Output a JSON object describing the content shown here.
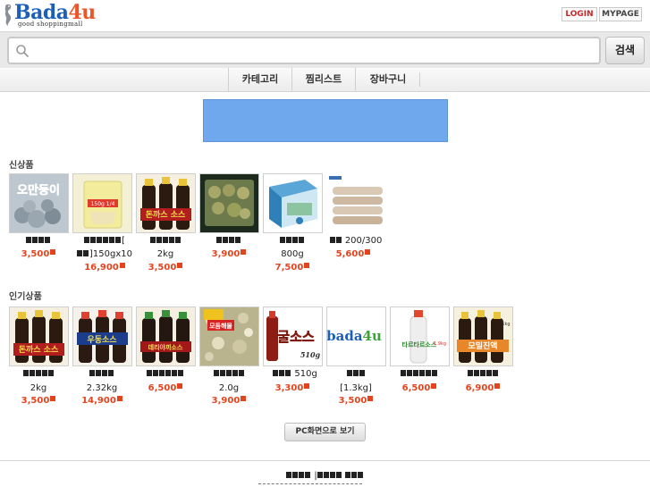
{
  "header": {
    "logo_main": "Bada",
    "logo_accent": "4u",
    "logo_sub": "good shoppingmall",
    "login_label": "LOGIN",
    "mypage_label": "MYPAGE"
  },
  "search": {
    "placeholder": "",
    "value": "",
    "button_label": "검색"
  },
  "nav": {
    "items": [
      {
        "label": "카테고리"
      },
      {
        "label": "찜리스트"
      },
      {
        "label": "장바구니"
      }
    ]
  },
  "colors": {
    "brand_blue": "#1d5fb8",
    "brand_orange": "#e8562a",
    "price_red": "#e3441e",
    "banner_blue": "#6fa8ec"
  },
  "new_products": {
    "title": "신상품",
    "items": [
      {
        "name": "",
        "detail": "",
        "price": "3,500",
        "thumb": "oman-fish"
      },
      {
        "name": "[",
        "detail": "]150gx10",
        "price": "16,900",
        "thumb": "pack-yellow"
      },
      {
        "name": "",
        "detail": "2kg",
        "price": "3,500",
        "thumb": "sauce-bottles"
      },
      {
        "name": "",
        "detail": "",
        "price": "3,900",
        "thumb": "green-tray"
      },
      {
        "name": "",
        "detail": "800g",
        "price": "7,500",
        "thumb": "blue-box"
      },
      {
        "name": "200/300",
        "detail": "",
        "price": "5,600",
        "thumb": "shrimp-rows"
      }
    ]
  },
  "popular_products": {
    "title": "인기상품",
    "items": [
      {
        "name": "",
        "detail": "2kg",
        "price": "3,500",
        "thumb": "sauce-bottles-red"
      },
      {
        "name": "",
        "detail": "2.32kg",
        "price": "14,900",
        "thumb": "sauce-bottles-udon"
      },
      {
        "name": "",
        "detail": "",
        "price": "6,500",
        "thumb": "sauce-bottles-teri"
      },
      {
        "name": "",
        "detail": "2.0g",
        "price": "3,900",
        "thumb": "seafood-mix"
      },
      {
        "name": "510g",
        "detail": "",
        "price": "3,300",
        "thumb": "clam-sauce"
      },
      {
        "name": "",
        "detail": "[1.3kg]",
        "price": "3,500",
        "thumb": "bada4u-logo"
      },
      {
        "name": "",
        "detail": "",
        "price": "6,500",
        "thumb": "tartar-sauce"
      },
      {
        "name": "",
        "detail": "",
        "price": "6,900",
        "thumb": "sauce-bottles-yellow"
      }
    ]
  },
  "thumb_text": {
    "oman": "오만둥이",
    "pack": "150g 1/4",
    "sauce_red": "돈까스 소스",
    "udon": "우동소스",
    "teri": "데리야끼소스",
    "seafood": "모듬해물",
    "clam": "굴소스",
    "clam_weight": "510g",
    "bada": "bada",
    "bada_accent": "4u",
    "tartar": "타르타르소스",
    "tartar_weight": "1.9kg",
    "yellow": "모밀진액",
    "yellow_weight": "1kg"
  },
  "pc_view_label": "PC화면으로 보기",
  "footer": {
    "separator": "|"
  }
}
